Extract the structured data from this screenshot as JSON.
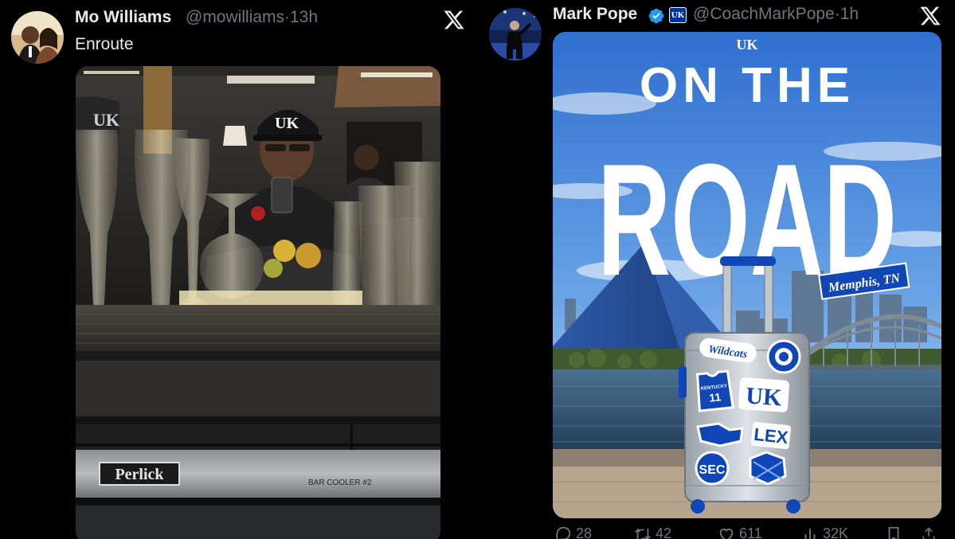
{
  "tweet_left": {
    "author_name": "Mo Williams",
    "handle": "@mowilliams",
    "separator": "·",
    "time": "13h",
    "text": "Enroute",
    "image": {
      "brand_plate": "Perlick",
      "cooler_label": "BAR COOLER #2",
      "cap_logo": "UK"
    }
  },
  "tweet_right": {
    "author_name": "Mark Pope",
    "affiliate_badge": "UK",
    "handle": "@CoachMarkPope",
    "separator": "·",
    "time": "1h",
    "image": {
      "top_logo": "UK",
      "headline_1": "ON THE",
      "headline_2": "ROAD",
      "location_tag": "Memphis, TN",
      "stickers": {
        "wildcats": "Wildcats",
        "jersey_top": "KENTUCKY",
        "jersey_number": "11",
        "uk": "UK",
        "lex": "LEX",
        "sec": "SEC"
      }
    },
    "actions": {
      "replies": "28",
      "reposts": "42",
      "likes": "611",
      "views": "32K"
    }
  }
}
